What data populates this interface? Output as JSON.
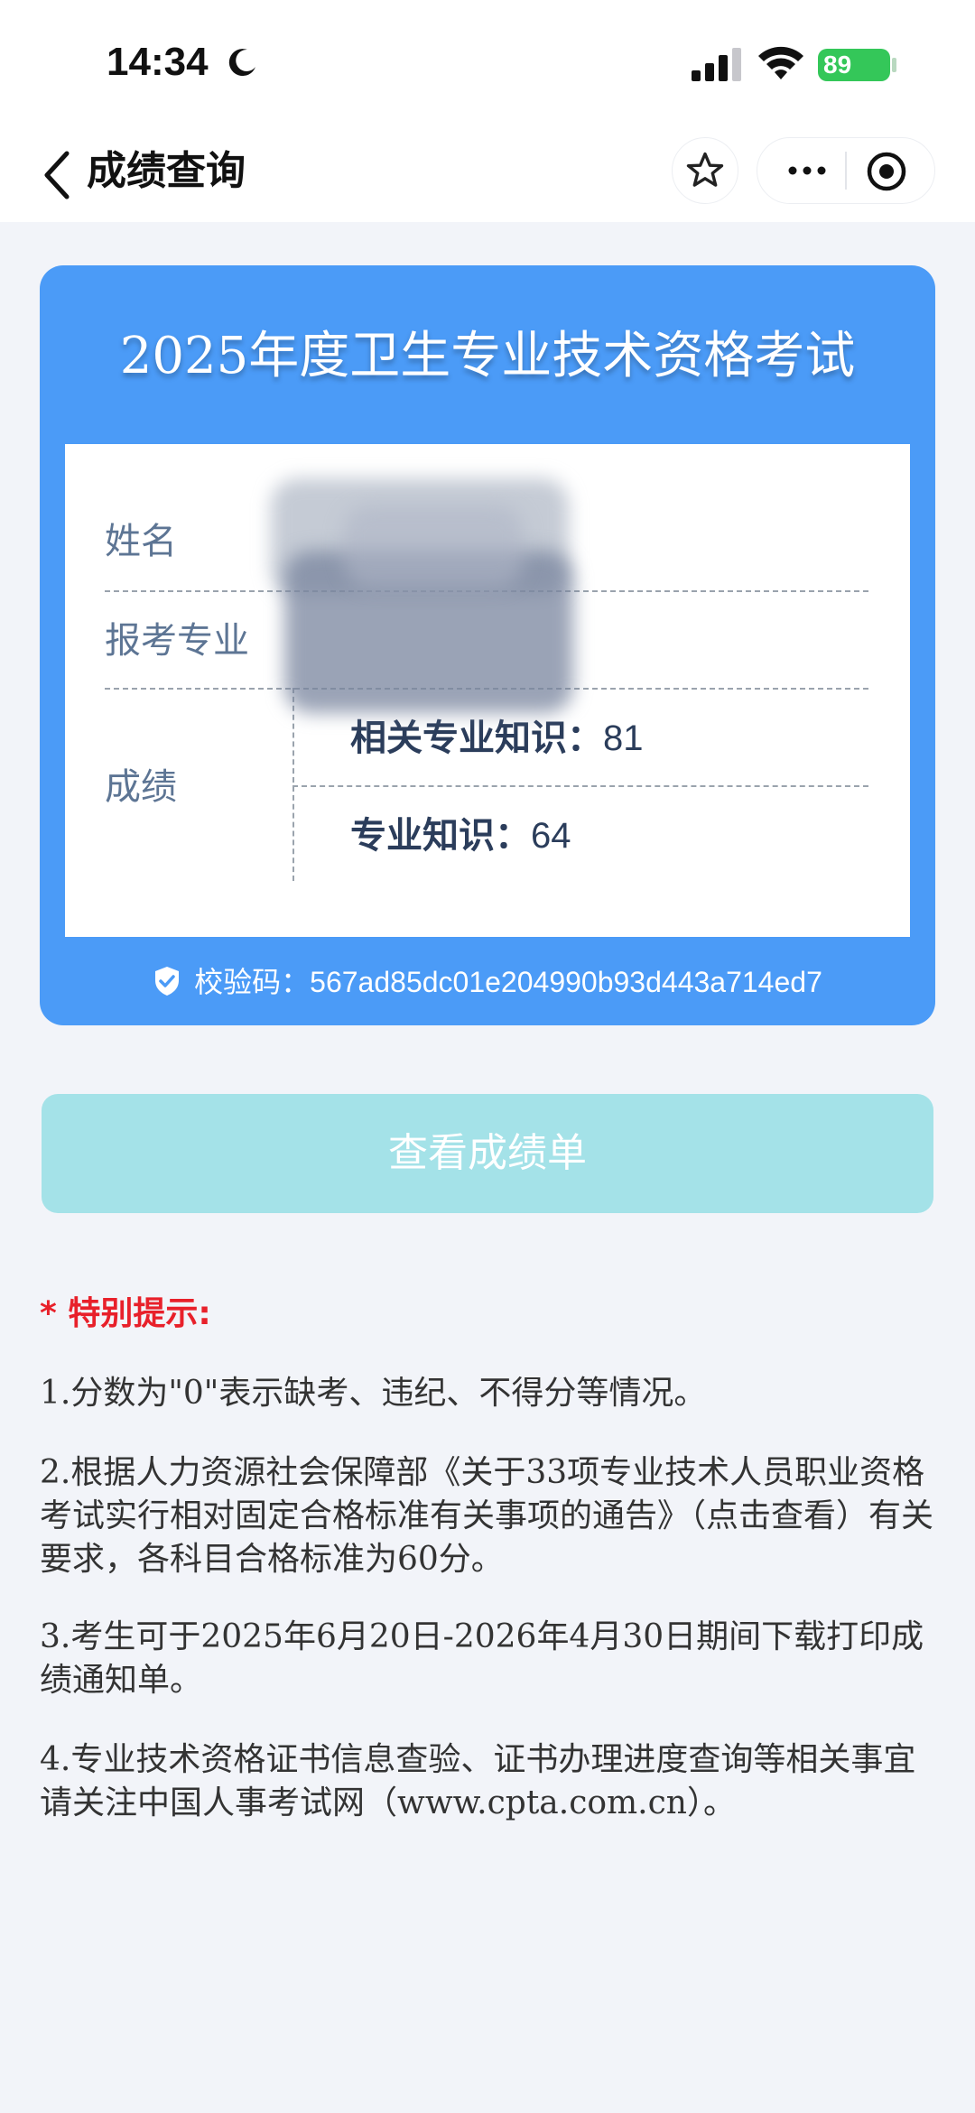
{
  "status_bar": {
    "time": "14:34",
    "battery": "89"
  },
  "nav": {
    "title": "成绩查询"
  },
  "card": {
    "title": "2025年度卫生专业技术资格考试",
    "name_label": "姓名",
    "specialty_label": "报考专业",
    "score_label": "成绩",
    "scores": [
      {
        "subject": "相关专业知识：",
        "value": "81"
      },
      {
        "subject": "专业知识：",
        "value": "64"
      }
    ],
    "verify_label": "校验码：",
    "verify_code": "567ad85dc01e204990b93d443a714ed7"
  },
  "button": {
    "label": "查看成绩单"
  },
  "notice": {
    "heading": "* 特别提示:",
    "items": [
      "1.分数为\"0\"表示缺考、违纪、不得分等情况。",
      "2.根据人力资源社会保障部《关于33项专业技术人员职业资格考试实行相对固定合格标准有关事项的通告》（点击查看）有关要求，各科目合格标准为60分。",
      "3.考生可于2025年6月20日-2026年4月30日期间下载打印成绩通知单。",
      "4.专业技术资格证书信息查验、证书办理进度查询等相关事宜请关注中国人事考试网（www.cpta.com.cn）。"
    ]
  },
  "colors": {
    "card_bg": "#4b9bf7",
    "button_bg": "#a4e2e8",
    "notice_red": "#e8202a",
    "battery_green": "#34c759"
  },
  "icons": [
    "moon-icon",
    "signal-icon",
    "wifi-icon",
    "back-chevron-icon",
    "star-icon",
    "more-icon",
    "target-icon",
    "shield-check-icon"
  ]
}
